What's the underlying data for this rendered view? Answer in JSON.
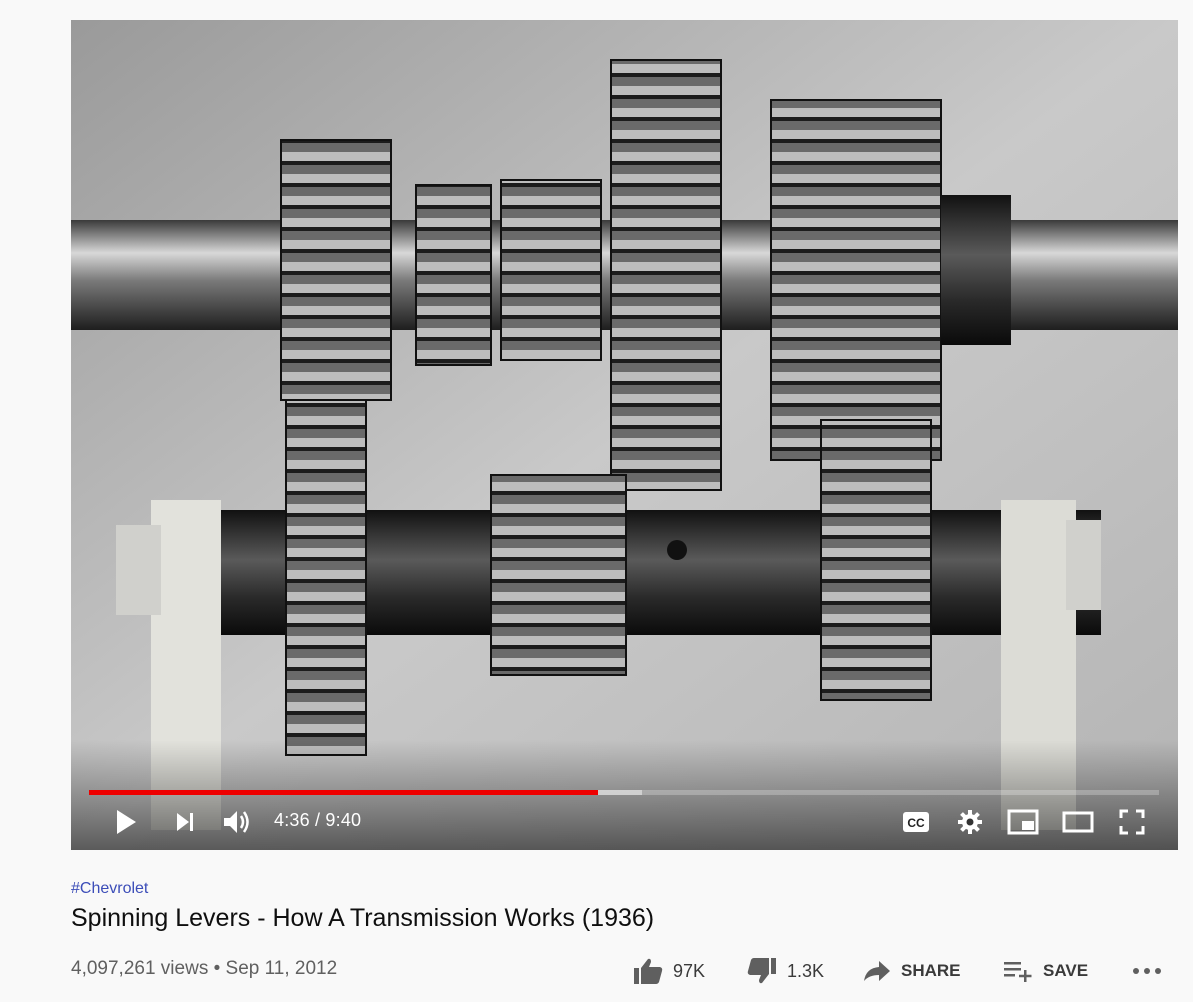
{
  "player": {
    "progress_fraction": 0.476,
    "buffered_fraction": 0.517,
    "current_time": "4:36",
    "duration": "9:40",
    "time_display": "4:36 / 9:40",
    "colors": {
      "played": "#e00000",
      "buffered": "#bcbcbc"
    },
    "icons": [
      "play-icon",
      "next-icon",
      "volume-icon",
      "cc-icon",
      "settings-icon",
      "miniplayer-icon",
      "theater-icon",
      "fullscreen-icon"
    ]
  },
  "video": {
    "hashtag": "#Chevrolet",
    "title": "Spinning Levers - How A Transmission Works (1936)",
    "stats": "4,097,261 views • Sep 11, 2012"
  },
  "actions": {
    "like_count": "97K",
    "dislike_count": "1.3K",
    "share_label": "SHARE",
    "save_label": "SAVE"
  }
}
